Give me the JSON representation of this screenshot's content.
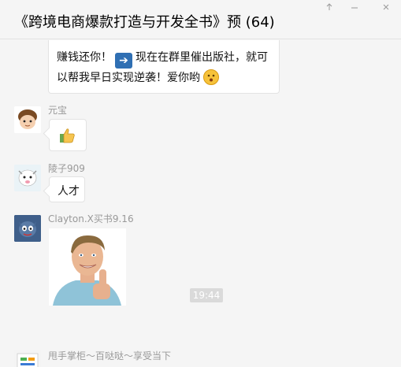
{
  "header": {
    "title": "《跨境电商爆款打造与开发全书》预 (64)"
  },
  "messages": [
    {
      "line1_a": "赚钱还你！",
      "line1_b": "现在在群里催出版社，就可",
      "line2": "以帮我早日实现逆袭！爱你哟"
    },
    {
      "sender": "元宝",
      "content": "thumbs-up sticker"
    },
    {
      "sender": "陵子909",
      "text": "人才"
    },
    {
      "sender": "Clayton.X买书9.16",
      "content": "photo of a smiling man giving a thumbs up"
    },
    {
      "sender": "甩手掌柜～百哒哒～享受当下"
    }
  ],
  "timestamp": "19:44",
  "colors": {
    "background": "#f5f5f5",
    "bubble": "#ffffff",
    "timestamp_bg": "#dadada"
  }
}
